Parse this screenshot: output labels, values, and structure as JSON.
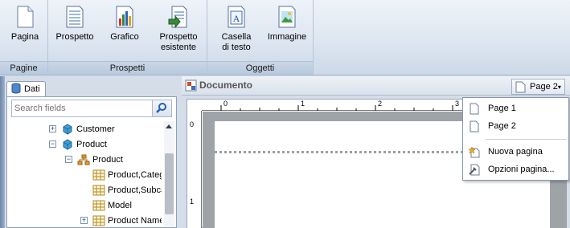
{
  "ribbon": {
    "groups": [
      {
        "title": "Pagine",
        "buttons": [
          {
            "label": "Pagina",
            "icon": "page-icon"
          }
        ]
      },
      {
        "title": "Prospetti",
        "buttons": [
          {
            "label": "Prospetto",
            "icon": "report-icon"
          },
          {
            "label": "Grafico",
            "icon": "chart-icon"
          },
          {
            "label": "Prospetto\nesistente",
            "icon": "existing-report-icon"
          }
        ]
      },
      {
        "title": "Oggetti",
        "buttons": [
          {
            "label": "Casella\ndi testo",
            "icon": "textbox-icon"
          },
          {
            "label": "Immagine",
            "icon": "image-icon"
          }
        ]
      }
    ]
  },
  "left_panel": {
    "tab_label": "Dati",
    "search_placeholder": "Search fields",
    "tree": [
      {
        "label": "Customer",
        "icon": "cube-icon",
        "expander": "+"
      },
      {
        "label": "Product",
        "icon": "cube-icon",
        "expander": "−"
      },
      {
        "label": "Product",
        "icon": "hierarchy-icon",
        "expander": "−"
      },
      {
        "label": "Product,Categ",
        "icon": "grid-icon",
        "expander": ""
      },
      {
        "label": "Product,Subca",
        "icon": "grid-icon",
        "expander": ""
      },
      {
        "label": "Model",
        "icon": "grid-icon",
        "expander": ""
      },
      {
        "label": "Product Name",
        "icon": "grid-icon",
        "expander": "+"
      }
    ]
  },
  "document": {
    "title": "Documento",
    "page_button": "Page 2",
    "ruler_top": [
      "0",
      "1",
      "2",
      "3"
    ],
    "ruler_left": [
      "0",
      "1"
    ]
  },
  "page_menu": {
    "items": [
      {
        "label": "Page 1",
        "icon": "page-icon"
      },
      {
        "label": "Page 2",
        "icon": "page-icon"
      },
      {
        "label": "Nuova pagina",
        "icon": "new-page-icon"
      },
      {
        "label": "Opzioni pagina...",
        "icon": "page-options-icon"
      }
    ]
  }
}
